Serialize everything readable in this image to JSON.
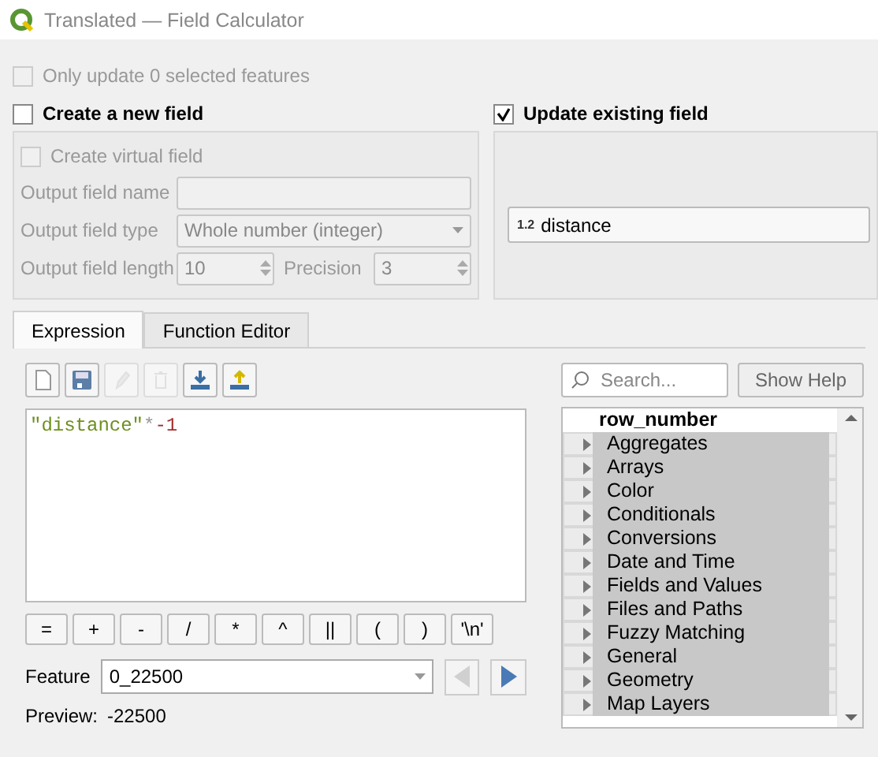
{
  "window": {
    "title": "Translated — Field Calculator"
  },
  "only_selected": {
    "label": "Only update 0 selected features",
    "checked": false,
    "disabled": true
  },
  "new_field": {
    "label": "Create a new field",
    "checked": false,
    "virtual": {
      "label": "Create virtual field",
      "checked": false
    },
    "name": {
      "label": "Output field name"
    },
    "type": {
      "label": "Output field type",
      "value": "Whole number (integer)"
    },
    "length": {
      "label": "Output field length",
      "value": "10"
    },
    "precision": {
      "label": "Precision",
      "value": "3"
    }
  },
  "update_field": {
    "label": "Update existing field",
    "checked": true,
    "field": {
      "badge": "1.2",
      "value": "distance"
    }
  },
  "tabs": [
    {
      "label": "Expression",
      "selected": true
    },
    {
      "label": "Function Editor",
      "selected": false
    }
  ],
  "toolbar": [
    {
      "kind": "new",
      "disabled": false
    },
    {
      "kind": "save",
      "disabled": false
    },
    {
      "kind": "edit",
      "disabled": true
    },
    {
      "kind": "delete",
      "disabled": true
    },
    {
      "kind": "import",
      "disabled": false
    },
    {
      "kind": "export",
      "disabled": false
    }
  ],
  "expression": [
    {
      "kind": "string",
      "text": "\"distance\""
    },
    {
      "kind": "operator",
      "text": "*"
    },
    {
      "kind": "number",
      "text": "-1"
    }
  ],
  "operators": [
    "=",
    "+",
    "-",
    "/",
    "*",
    "^",
    "||",
    "(",
    ")",
    "'\\n'"
  ],
  "feature": {
    "label": "Feature",
    "value": "0_22500",
    "prev_disabled": true,
    "next_disabled": false
  },
  "preview": {
    "label": "Preview:",
    "value": "-22500"
  },
  "search": {
    "placeholder": "Search..."
  },
  "show_help": "Show Help",
  "functions": [
    {
      "label": "row_number",
      "kind": "function"
    },
    {
      "label": "Aggregates",
      "kind": "group"
    },
    {
      "label": "Arrays",
      "kind": "group"
    },
    {
      "label": "Color",
      "kind": "group"
    },
    {
      "label": "Conditionals",
      "kind": "group"
    },
    {
      "label": "Conversions",
      "kind": "group"
    },
    {
      "label": "Date and Time",
      "kind": "group"
    },
    {
      "label": "Fields and Values",
      "kind": "group"
    },
    {
      "label": "Files and Paths",
      "kind": "group"
    },
    {
      "label": "Fuzzy Matching",
      "kind": "group"
    },
    {
      "label": "General",
      "kind": "group"
    },
    {
      "label": "Geometry",
      "kind": "group"
    },
    {
      "label": "Map Layers",
      "kind": "group"
    }
  ]
}
